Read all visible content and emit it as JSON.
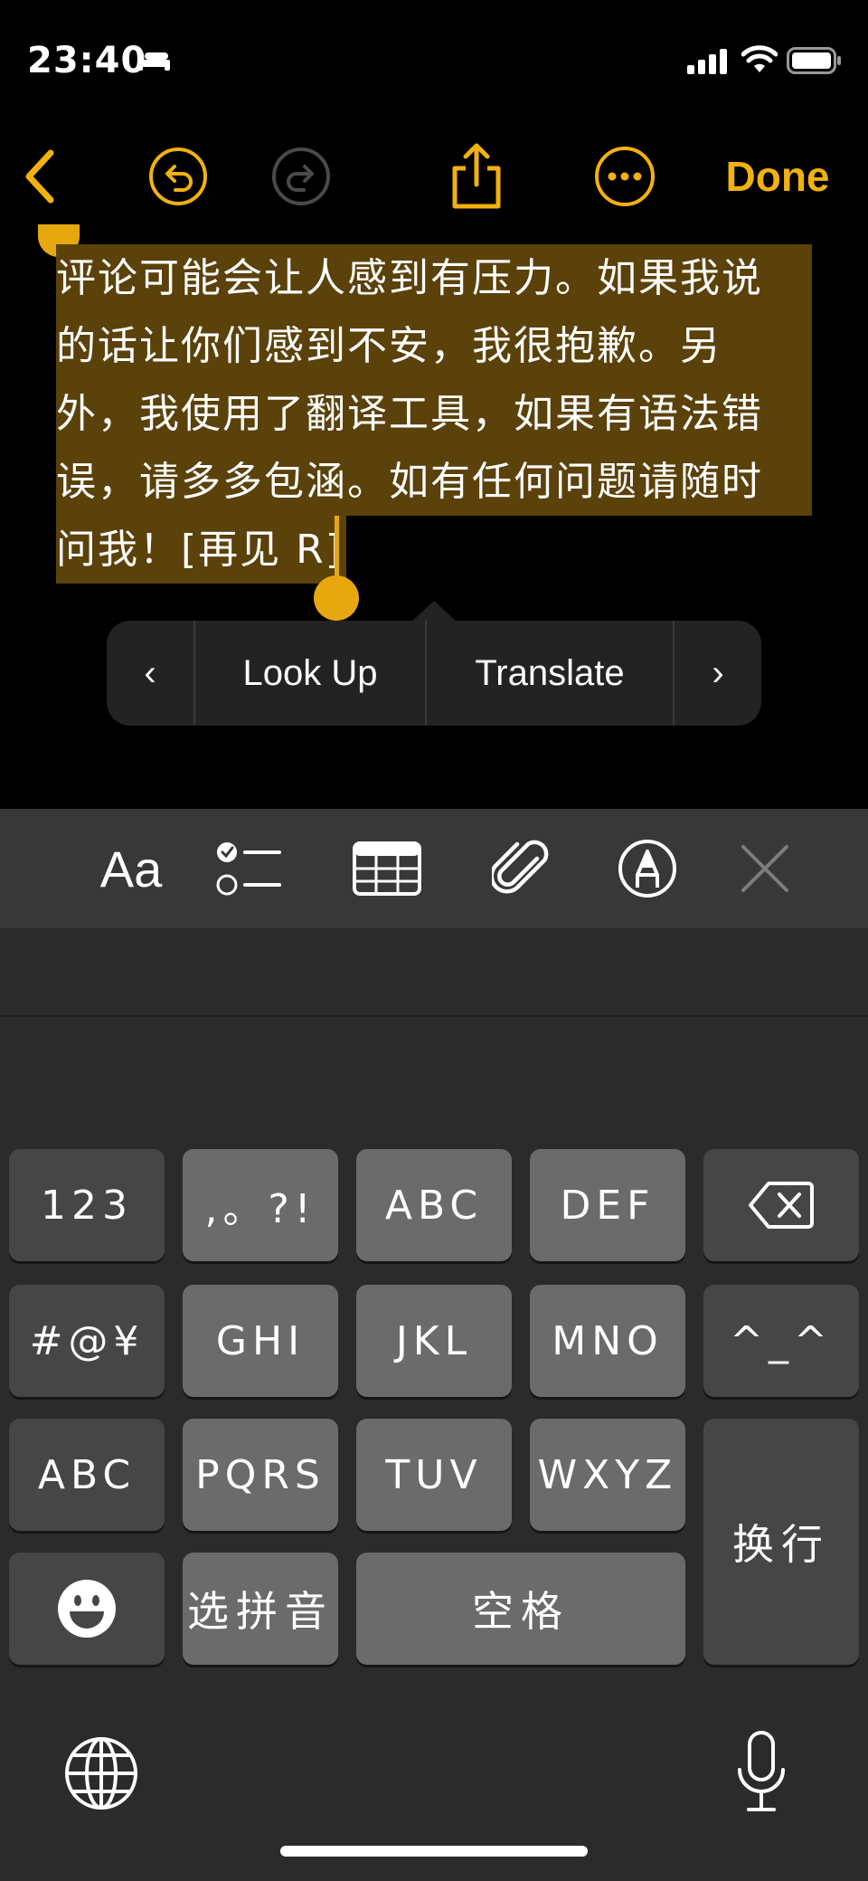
{
  "status_bar": {
    "time": "23:40",
    "icons": [
      "bed-icon",
      "cellular-signal-icon",
      "wifi-icon",
      "battery-icon"
    ]
  },
  "toolbar": {
    "back_icon": "chevron-left-icon",
    "undo_icon": "undo-icon",
    "redo_icon": "redo-icon",
    "share_icon": "share-icon",
    "more_icon": "ellipsis-circle-icon",
    "done_label": "Done",
    "accent_color": "#F2B10E"
  },
  "note": {
    "lines": [
      "评论可能会让人感到有压力。如果我说",
      "的话让你们感到不安，我很抱歉。另",
      "外，我使用了翻译工具，如果有语法错",
      "误，请多多包涵。如有任何问题请随时",
      "问我！[再见 R]"
    ],
    "selection_color": "#5B410A"
  },
  "edit_menu": {
    "prev": "‹",
    "items": [
      "Look Up",
      "Translate"
    ],
    "next": "›"
  },
  "format_bar": {
    "text_style_label": "Aa",
    "icons": [
      "checklist-icon",
      "table-icon",
      "paperclip-icon",
      "markup-pen-icon",
      "close-icon"
    ]
  },
  "keyboard": {
    "row1": [
      "123",
      ",。?!",
      "ABC",
      "DEF"
    ],
    "row2": [
      "#@¥",
      "GHI",
      "JKL",
      "MNO",
      "^_^"
    ],
    "row3": [
      "ABC",
      "PQRS",
      "TUV",
      "WXYZ"
    ],
    "row4": [
      "选拼音",
      "空格"
    ],
    "return_label": "换行",
    "delete_icon": "delete-backward-icon",
    "emoji_icon": "emoji-icon",
    "globe_icon": "globe-icon",
    "mic_icon": "microphone-icon"
  }
}
